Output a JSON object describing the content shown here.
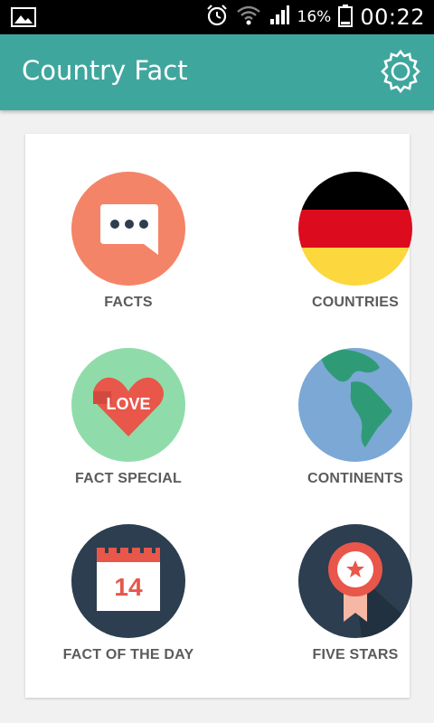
{
  "status_bar": {
    "battery": "16%",
    "time": "00:22",
    "icons": [
      "image-icon",
      "alarm-icon",
      "wifi-icon",
      "signal-icon",
      "battery-icon"
    ]
  },
  "app_bar": {
    "title": "Country Fact",
    "settings_icon": "gear-icon"
  },
  "menu": {
    "items": [
      {
        "label": "FACTS",
        "icon": "chat-bubble-icon"
      },
      {
        "label": "COUNTRIES",
        "icon": "germany-flag-icon"
      },
      {
        "label": "FACT SPECIAL",
        "icon": "love-heart-icon"
      },
      {
        "label": "CONTINENTS",
        "icon": "globe-icon"
      },
      {
        "label": "FACT OF THE DAY",
        "icon": "calendar-icon",
        "calendar_day": "14"
      },
      {
        "label": "FIVE STARS",
        "icon": "award-ribbon-icon"
      }
    ]
  },
  "colors": {
    "app_bar": "#3fa69e",
    "facts": "#f48467",
    "fact_special": "#8fdcaa",
    "continents": "#7ca8d6",
    "navy": "#2c3e50"
  }
}
